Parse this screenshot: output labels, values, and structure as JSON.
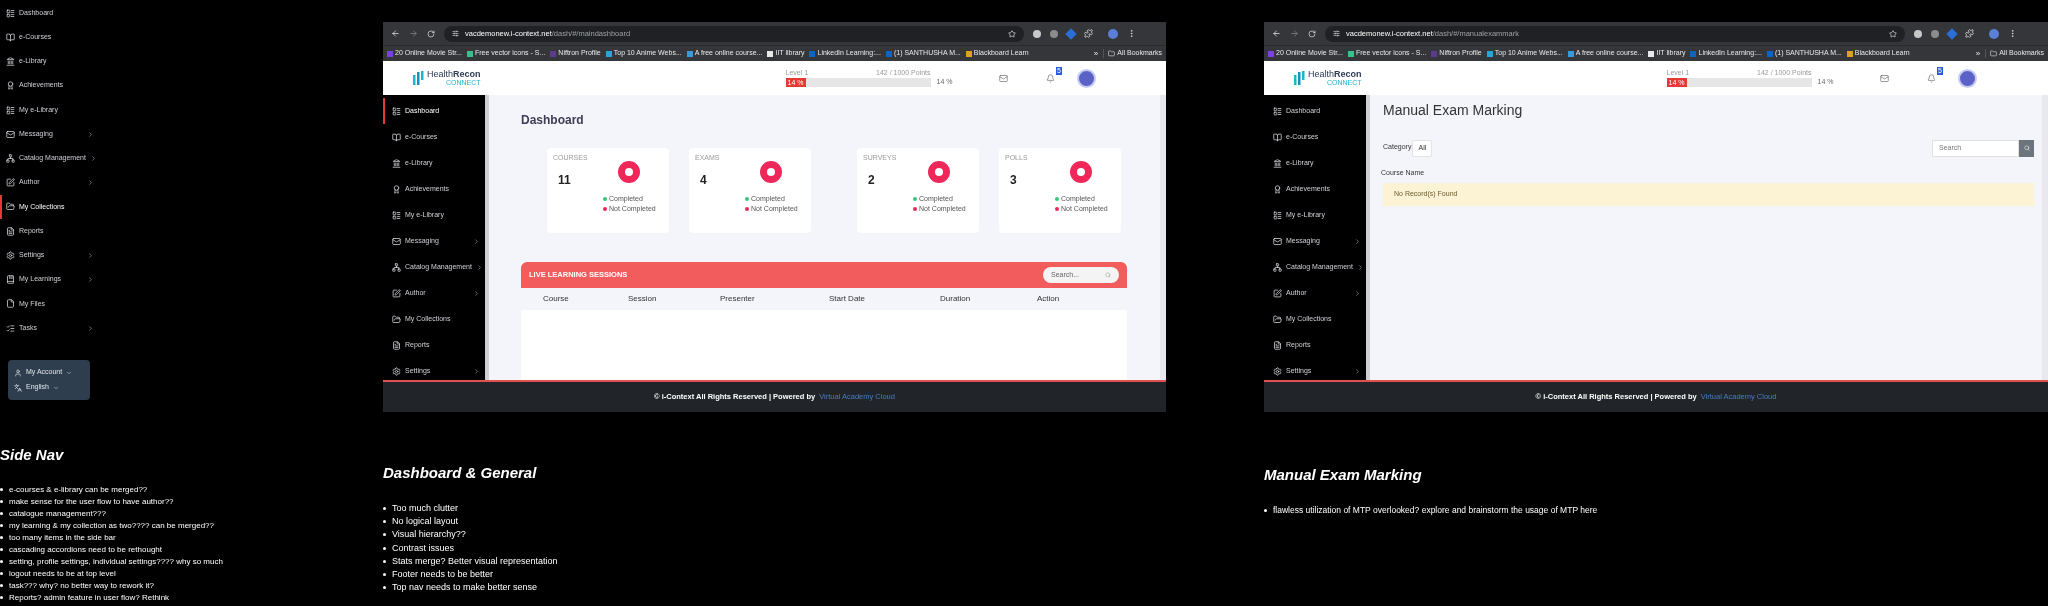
{
  "side_nav_panel": {
    "items": [
      {
        "label": "Dashboard",
        "selected": false,
        "expandable": false
      },
      {
        "label": "e-Courses",
        "selected": false,
        "expandable": false
      },
      {
        "label": "e-Library",
        "selected": false,
        "expandable": false
      },
      {
        "label": "Achievements",
        "selected": false,
        "expandable": false
      },
      {
        "label": "My e-Library",
        "selected": false,
        "expandable": false
      },
      {
        "label": "Messaging",
        "selected": false,
        "expandable": true
      },
      {
        "label": "Catalog Management",
        "selected": false,
        "expandable": true
      },
      {
        "label": "Author",
        "selected": false,
        "expandable": true
      },
      {
        "label": "My Collections",
        "selected": true,
        "expandable": false
      },
      {
        "label": "Reports",
        "selected": false,
        "expandable": false
      },
      {
        "label": "Settings",
        "selected": false,
        "expandable": true
      },
      {
        "label": "My Learnings",
        "selected": false,
        "expandable": true
      },
      {
        "label": "My Files",
        "selected": false,
        "expandable": false
      },
      {
        "label": "Tasks",
        "selected": false,
        "expandable": true
      }
    ],
    "account": [
      {
        "label": "My Account"
      },
      {
        "label": "English"
      }
    ]
  },
  "screens": [
    {
      "browser": {
        "url_host": "vacdemonew.i-context.net",
        "url_path": "/dash/#/maindashboard",
        "bookmarks": [
          {
            "label": "20 Online Movie Str...",
            "color": "#7b3fe4"
          },
          {
            "label": "Free vector icons - S...",
            "color": "#33c48d"
          },
          {
            "label": "Niftron Profile",
            "color": "#5b3c8c"
          },
          {
            "label": "Top 10 Anime Webs...",
            "color": "#2aa3d6"
          },
          {
            "label": "A free online course...",
            "color": "#3a9ad9"
          },
          {
            "label": "IIT library",
            "color": "#e8e8e8"
          },
          {
            "label": "LinkedIn Learning:...",
            "color": "#0a66c2"
          },
          {
            "label": "(1) SANTHUSHA M...",
            "color": "#0a66c2"
          },
          {
            "label": "Blackboard Learn",
            "color": "#e0a020"
          }
        ],
        "overflow": "»",
        "all_bookmarks": "All Bookmarks"
      },
      "header": {
        "logo": "Health**Recon**",
        "logo_sub": "CONNECT",
        "level_label": "Level 1",
        "points": "142 / 1000 Points",
        "progress": {
          "level": 0.14,
          "label": "14 %"
        },
        "percent": "14 %",
        "badge": "5"
      },
      "sidebar": [
        {
          "label": "Dashboard",
          "selected": true,
          "expandable": false
        },
        {
          "label": "e-Courses",
          "selected": false,
          "expandable": false
        },
        {
          "label": "e-Library",
          "selected": false,
          "expandable": false
        },
        {
          "label": "Achievements",
          "selected": false,
          "expandable": false
        },
        {
          "label": "My e-Library",
          "selected": false,
          "expandable": false
        },
        {
          "label": "Messaging",
          "selected": false,
          "expandable": true
        },
        {
          "label": "Catalog Management",
          "selected": false,
          "expandable": true
        },
        {
          "label": "Author",
          "selected": false,
          "expandable": true
        },
        {
          "label": "My Collections",
          "selected": false,
          "expandable": false
        },
        {
          "label": "Reports",
          "selected": false,
          "expandable": false
        },
        {
          "label": "Settings",
          "selected": false,
          "expandable": true
        }
      ],
      "content": {
        "kind": "dashboard",
        "title": "Dashboard",
        "stats": [
          {
            "label": "COURSES",
            "value": "11",
            "legend": [
              {
                "label": "Completed",
                "color": "#3cc47c"
              },
              {
                "label": "Not Completed",
                "color": "#f0285a"
              }
            ]
          },
          {
            "label": "EXAMS",
            "value": "4",
            "legend": [
              {
                "label": "Completed",
                "color": "#3cc47c"
              },
              {
                "label": "Not Completed",
                "color": "#f0285a"
              }
            ]
          },
          {
            "label": "SURVEYS",
            "value": "2",
            "legend": [
              {
                "label": "Completed",
                "color": "#3cc47c"
              },
              {
                "label": "Not Completed",
                "color": "#f0285a"
              }
            ]
          },
          {
            "label": "POLLS",
            "value": "3",
            "legend": [
              {
                "label": "Completed",
                "color": "#3cc47c"
              },
              {
                "label": "Not Completed",
                "color": "#f0285a"
              }
            ]
          }
        ],
        "sessions": {
          "title": "LIVE LEARNING SESSIONS",
          "search_placeholder": "Search...",
          "columns": [
            "Course",
            "Session",
            "Presenter",
            "Start Date",
            "Duration",
            "Action"
          ]
        }
      },
      "footer": {
        "text": "© i-Context All Rights Reserved | Powered by",
        "link": "Virtual Academy Cloud"
      }
    },
    {
      "browser": {
        "url_host": "vacdemonew.i-context.net",
        "url_path": "/dash/#/manualexammark",
        "bookmarks": [
          {
            "label": "20 Online Movie Str...",
            "color": "#7b3fe4"
          },
          {
            "label": "Free vector icons - S...",
            "color": "#33c48d"
          },
          {
            "label": "Niftron Profile",
            "color": "#5b3c8c"
          },
          {
            "label": "Top 10 Anime Webs...",
            "color": "#2aa3d6"
          },
          {
            "label": "A free online course...",
            "color": "#3a9ad9"
          },
          {
            "label": "IIT library",
            "color": "#e8e8e8"
          },
          {
            "label": "LinkedIn Learning:...",
            "color": "#0a66c2"
          },
          {
            "label": "(1) SANTHUSHA M...",
            "color": "#0a66c2"
          },
          {
            "label": "Blackboard Learn",
            "color": "#e0a020"
          }
        ],
        "overflow": "»",
        "all_bookmarks": "All Bookmarks"
      },
      "header": {
        "logo": "Health**Recon**",
        "logo_sub": "CONNECT",
        "level_label": "Level 1",
        "points": "142 / 1000 Points",
        "progress": {
          "level": 0.14,
          "label": "14 %"
        },
        "percent": "14 %",
        "badge": "5"
      },
      "sidebar": [
        {
          "label": "Dashboard",
          "selected": false,
          "expandable": false
        },
        {
          "label": "e-Courses",
          "selected": false,
          "expandable": false
        },
        {
          "label": "e-Library",
          "selected": false,
          "expandable": false
        },
        {
          "label": "Achievements",
          "selected": false,
          "expandable": false
        },
        {
          "label": "My e-Library",
          "selected": false,
          "expandable": false
        },
        {
          "label": "Messaging",
          "selected": false,
          "expandable": true
        },
        {
          "label": "Catalog Management",
          "selected": false,
          "expandable": true
        },
        {
          "label": "Author",
          "selected": false,
          "expandable": true
        },
        {
          "label": "My Collections",
          "selected": false,
          "expandable": false
        },
        {
          "label": "Reports",
          "selected": false,
          "expandable": false
        },
        {
          "label": "Settings",
          "selected": false,
          "expandable": true
        }
      ],
      "content": {
        "kind": "exam_marking",
        "title": "Manual Exam Marking",
        "category_label": "Category",
        "category_value": "All",
        "search_placeholder": "Search",
        "column": "Course Name",
        "empty_message": "No Record(s) Found"
      },
      "footer": {
        "text": "© i-Context All Rights Reserved | Powered by",
        "link": "Virtual Academy Cloud"
      }
    }
  ],
  "notes": [
    {
      "title": "Side Nav",
      "bullets": [
        "e-courses & e-library can be merged??",
        "make sense for the user flow to have author??",
        "catalogue management???",
        "my learning & my collection as two???? can be merged??",
        "too many items in the side bar",
        "cascading accordions need to be rethought",
        "setting, profile settings, individual settings???? why so much",
        "logout needs to be at top level",
        "task??? why? no better way to rework it?",
        "Reports? admin feature in user flow? Rethink"
      ]
    },
    {
      "title": "Dashboard & General",
      "bullets": [
        "Too much clutter",
        "No logical layout",
        "Visual hierarchy??",
        "Contrast issues",
        "Stats merge? Better visual representation",
        "Footer needs to be better",
        "Top nav needs to make better sense"
      ]
    },
    {
      "title": "Manual Exam Marking",
      "bullets": [
        "flawless utilization of MTP overlooked? explore and brainstorm the usage of MTP here"
      ]
    }
  ]
}
